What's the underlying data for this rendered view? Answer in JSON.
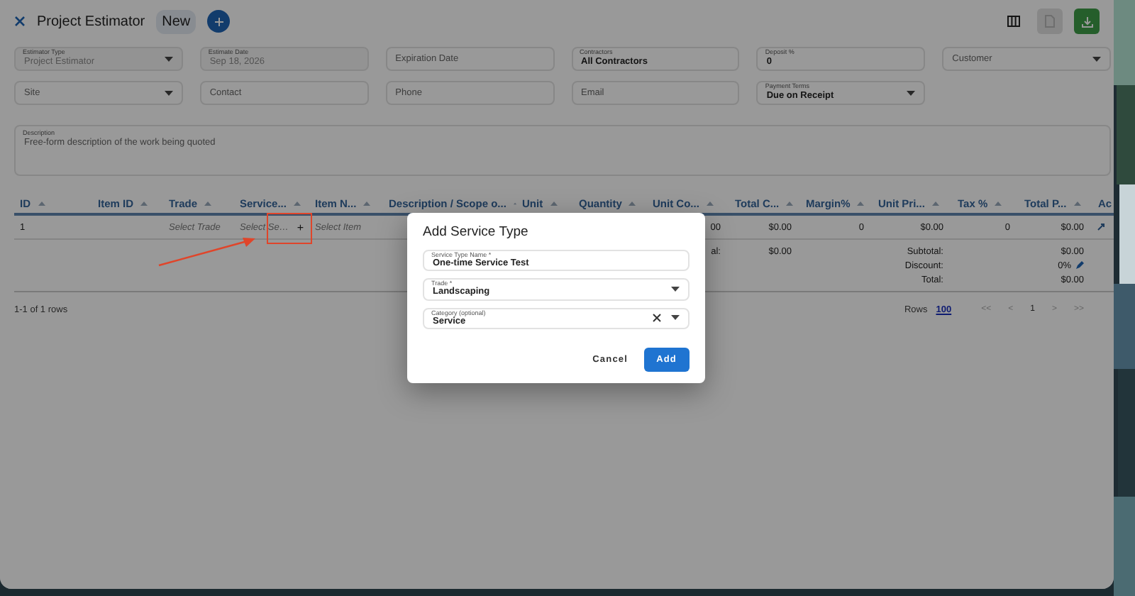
{
  "header": {
    "title": "Project Estimator",
    "status": "New",
    "actions": [
      {
        "kind": "columns",
        "disabled": false
      },
      {
        "kind": "document",
        "disabled": true
      },
      {
        "kind": "download",
        "disabled": false
      }
    ]
  },
  "form": {
    "fields": [
      {
        "kind": "select",
        "label": "Estimator Type",
        "value": "Project Estimator",
        "disabled": true
      },
      {
        "kind": "date",
        "label": "Estimate Date",
        "value": "Sep 18, 2026",
        "disabled": true
      },
      {
        "kind": "date",
        "placeholder": "Expiration Date"
      },
      {
        "kind": "text",
        "label": "Contractors",
        "value": "All Contractors"
      },
      {
        "kind": "text",
        "label": "Deposit %",
        "value": "0"
      },
      {
        "kind": "select",
        "placeholder": "Customer"
      },
      {
        "kind": "select",
        "placeholder": "Site"
      },
      {
        "kind": "text",
        "placeholder": "Contact"
      },
      {
        "kind": "text",
        "placeholder": "Phone"
      },
      {
        "kind": "text",
        "placeholder": "Email"
      },
      {
        "kind": "select",
        "label": "Payment Terms",
        "value": "Due on Receipt"
      }
    ],
    "description": {
      "label": "Description",
      "placeholder": "Free-form description of the work being quoted"
    }
  },
  "table": {
    "columns": [
      {
        "label": "ID",
        "sortable": true
      },
      {
        "label": "Item ID",
        "sortable": true
      },
      {
        "label": "Trade",
        "sortable": true
      },
      {
        "label": "Service...",
        "sortable": true
      },
      {
        "label": "Item N...",
        "sortable": true
      },
      {
        "label": "Description / Scope o...",
        "sortable": true
      },
      {
        "label": "Unit",
        "sortable": true
      },
      {
        "label": "Quantity",
        "sortable": true
      },
      {
        "label": "Unit Co...",
        "sortable": true
      },
      {
        "label": "Total C...",
        "sortable": true
      },
      {
        "label": "Margin%",
        "sortable": true
      },
      {
        "label": "Unit Pri...",
        "sortable": true
      },
      {
        "label": "Tax %",
        "sortable": true
      },
      {
        "label": "Total P...",
        "sortable": true
      },
      {
        "label": "Ac"
      }
    ],
    "rows": [
      {
        "cells": [
          {
            "kind": "text",
            "text": "1"
          },
          {
            "kind": "empty"
          },
          {
            "kind": "placeholder",
            "text": "Select Trade"
          },
          {
            "kind": "add",
            "text": "Select Se…",
            "button": "+",
            "highlighted": true
          },
          {
            "kind": "placeholder",
            "text": "Select Item"
          },
          {
            "kind": "empty"
          },
          {
            "kind": "empty"
          },
          {
            "kind": "empty"
          },
          {
            "kind": "number",
            "text": "00"
          },
          {
            "kind": "number",
            "text": "$0.00"
          },
          {
            "kind": "number",
            "text": "0"
          },
          {
            "kind": "number",
            "text": "$0.00"
          },
          {
            "kind": "number",
            "text": "0"
          },
          {
            "kind": "number",
            "text": "$0.00"
          },
          {
            "kind": "action"
          }
        ]
      }
    ],
    "cost_total": {
      "label": "al:",
      "value": "$0.00"
    },
    "totals": [
      {
        "label": "Subtotal:",
        "value": "$0.00"
      },
      {
        "label": "Discount:",
        "value": "0%",
        "editable": true
      },
      {
        "label": "Total:",
        "value": "$0.00"
      }
    ],
    "footer": {
      "count": "1-1 of 1 rows",
      "rows_label": "Rows",
      "rows_value": "100",
      "pager": [
        {
          "label": "<<",
          "disabled": true
        },
        {
          "label": "<",
          "disabled": true
        },
        {
          "label": "1",
          "disabled": false
        },
        {
          "label": ">",
          "disabled": true
        },
        {
          "label": ">>",
          "disabled": true
        }
      ]
    }
  },
  "dialog": {
    "title": "Add Service Type",
    "fields": [
      {
        "kind": "text",
        "label": "Service Type Name *",
        "value": "One-time Service Test"
      },
      {
        "kind": "select",
        "label": "Trade *",
        "value": "Landscaping"
      },
      {
        "kind": "select",
        "label": "Category (optional)",
        "value": "Service",
        "clearable": true
      }
    ],
    "buttons": [
      {
        "kind": "text",
        "label": "Cancel"
      },
      {
        "kind": "primary",
        "label": "Add"
      }
    ]
  }
}
